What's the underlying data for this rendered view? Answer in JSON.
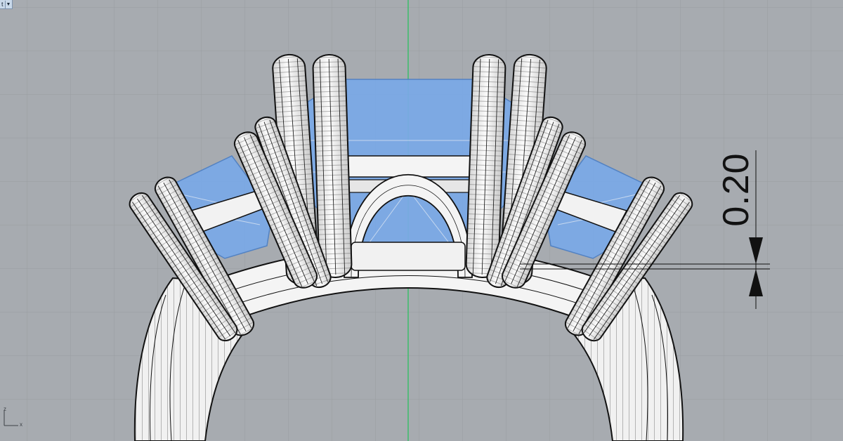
{
  "viewport": {
    "tab_label": "t",
    "tab_dropdown_icon": "triangle-down-icon",
    "background": "#a7abb0",
    "grid_color": "#989ca1",
    "vertical_axis_color": "#22c25a"
  },
  "axis_widget": {
    "z_label": "z",
    "x_label": "x"
  },
  "dimension": {
    "value_text": "0.20",
    "arrow_icon": "dimension-arrow-icon"
  },
  "model": {
    "metal_color": "#f2f2f2",
    "gem_color": "#7aa9e8",
    "wire_color": "#111111"
  }
}
